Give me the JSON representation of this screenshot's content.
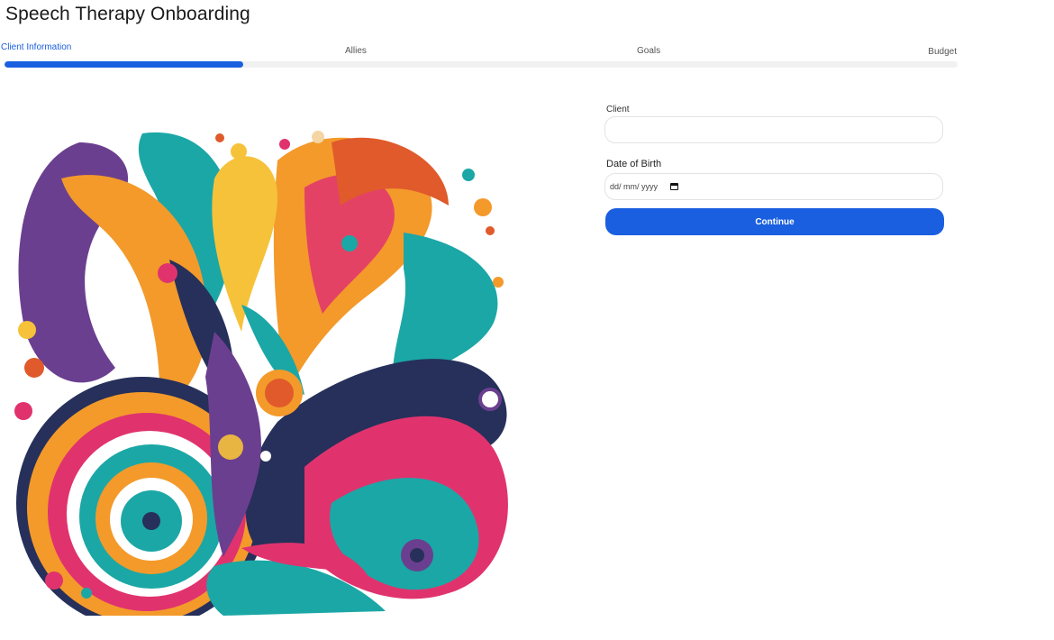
{
  "page": {
    "title": "Speech Therapy Onboarding"
  },
  "stepper": {
    "steps": [
      {
        "label": "Client Information",
        "active": true
      },
      {
        "label": "Allies",
        "active": false
      },
      {
        "label": "Goals",
        "active": false
      },
      {
        "label": "Budget",
        "active": false
      }
    ],
    "progress_fraction": 0.25
  },
  "hero_image": {
    "alt": "colorful abstract swirl illustration"
  },
  "form": {
    "client": {
      "label": "Client",
      "value": ""
    },
    "date_of_birth": {
      "label": "Date of Birth",
      "placeholder": "dd/ mm/ yyyy",
      "icon": "calendar-icon"
    },
    "continue_label": "Continue"
  },
  "colors": {
    "accent": "#1a5fe0",
    "track": "#f1f1f1",
    "teal": "#1ba7a6",
    "orange": "#f39a2b",
    "pink": "#e0336e",
    "purple": "#6b3f8f",
    "navy": "#26305a"
  }
}
